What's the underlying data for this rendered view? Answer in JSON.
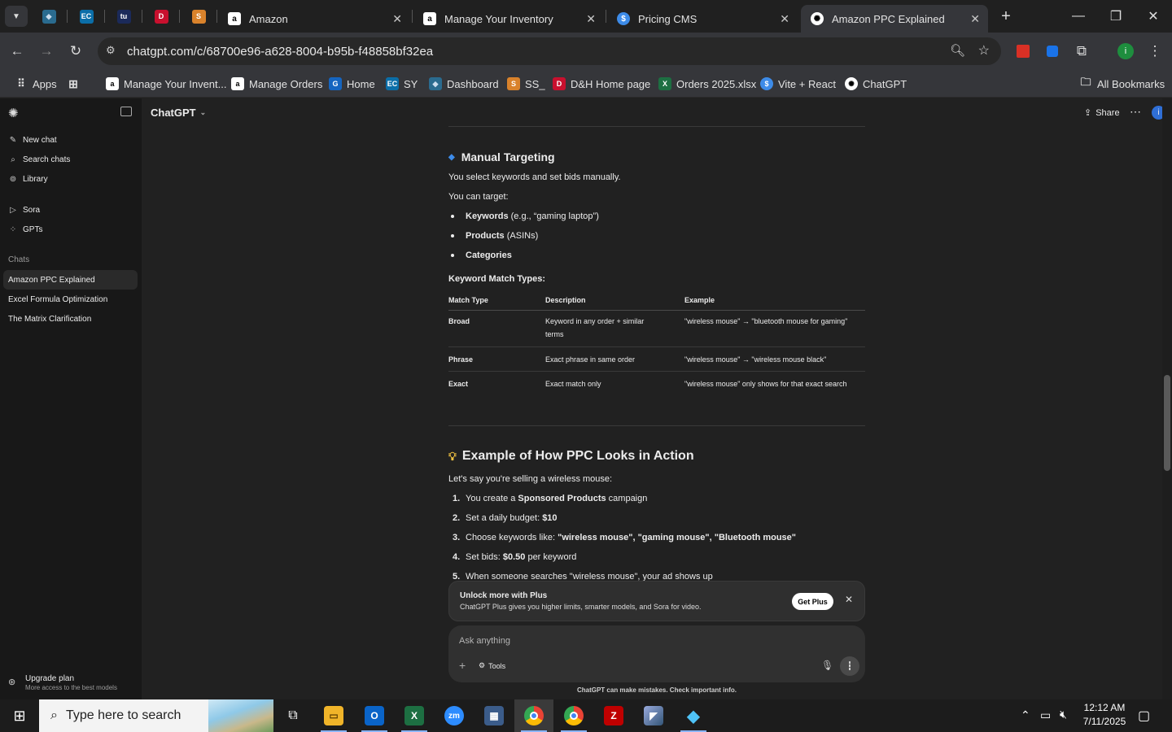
{
  "browser": {
    "tabs": [
      {
        "title": "Amazon",
        "icon": "amazon-icon"
      },
      {
        "title": "Manage Your Inventory",
        "icon": "amazon-icon"
      },
      {
        "title": "Pricing CMS",
        "icon": "dollar-icon"
      },
      {
        "title": "Amazon PPC Explained",
        "icon": "chatgpt-icon",
        "active": true
      }
    ],
    "pinned_icons": [
      "ds-icon",
      "ec-icon",
      "tasks-icon",
      "dh-icon",
      "ss-icon"
    ],
    "url": "chatgpt.com/c/68700e96-a628-8004-b95b-f48858bf32ea",
    "bookmarks": [
      "Apps",
      "Manage Your Invent...",
      "Manage Orders",
      "Home",
      "SY",
      "Dashboard",
      "SS_",
      "D&H Home page",
      "Orders 2025.xlsx",
      "Vite + React",
      "ChatGPT"
    ],
    "all_bookmarks": "All Bookmarks",
    "profile_initial": "i"
  },
  "sidebar": {
    "actions": [
      {
        "label": "New chat",
        "icon": "compose-icon"
      },
      {
        "label": "Search chats",
        "icon": "search-icon"
      },
      {
        "label": "Library",
        "icon": "library-icon"
      }
    ],
    "apps": [
      {
        "label": "Sora",
        "icon": "sora-icon"
      },
      {
        "label": "GPTs",
        "icon": "grid-icon"
      }
    ],
    "chats_heading": "Chats",
    "chats": [
      "Amazon PPC Explained",
      "Excel Formula Optimization",
      "The Matrix Clarification"
    ],
    "upgrade_title": "Upgrade plan",
    "upgrade_sub": "More access to the best models"
  },
  "header": {
    "model": "ChatGPT",
    "share": "Share",
    "profile_initial": "i"
  },
  "content": {
    "manual_title": "Manual Targeting",
    "manual_p1": "You select keywords and set bids manually.",
    "manual_p2": "You can target:",
    "targets": [
      {
        "bold": "Keywords",
        "rest": " (e.g., “gaming laptop”)"
      },
      {
        "bold": "Products",
        "rest": " (ASINs)"
      },
      {
        "bold": "Categories",
        "rest": ""
      }
    ],
    "match_heading": "Keyword Match Types:",
    "table_headers": [
      "Match Type",
      "Description",
      "Example"
    ],
    "table_rows": [
      [
        "Broad",
        "Keyword in any order + similar terms",
        "\"wireless mouse\" → \"bluetooth mouse for gaming\""
      ],
      [
        "Phrase",
        "Exact phrase in same order",
        "\"wireless mouse\" → \"wireless mouse black\""
      ],
      [
        "Exact",
        "Exact match only",
        "\"wireless mouse\" only shows for that exact search"
      ]
    ],
    "example_title": "Example of How PPC Looks in Action",
    "example_intro": "Let's say you're selling a wireless mouse:",
    "steps": [
      {
        "pre": "You create a ",
        "bold": "Sponsored Products",
        "post": " campaign"
      },
      {
        "pre": "Set a daily budget: ",
        "bold": "$10",
        "post": ""
      },
      {
        "pre": "Choose keywords like: ",
        "bold": "\"wireless mouse\", \"gaming mouse\", \"Bluetooth mouse\"",
        "post": ""
      },
      {
        "pre": "Set bids: ",
        "bold": "$0.50",
        "post": " per keyword"
      },
      {
        "pre": "When someone searches \"wireless mouse\", your ad shows up",
        "bold": "",
        "post": ""
      }
    ]
  },
  "plus_banner": {
    "title": "Unlock more with Plus",
    "sub": "ChatGPT Plus gives you higher limits, smarter models, and Sora for video.",
    "button": "Get Plus"
  },
  "composer": {
    "placeholder": "Ask anything",
    "tools": "Tools",
    "disclaimer": "ChatGPT can make mistakes. Check important info."
  },
  "taskbar": {
    "search_placeholder": "Type here to search",
    "time": "12:12 AM",
    "date": "7/11/2025"
  },
  "colors": {
    "accent": "#8ab4f8",
    "sidebar_bg": "#181818",
    "main_bg": "#212121",
    "profile": "#2f6fd6"
  }
}
